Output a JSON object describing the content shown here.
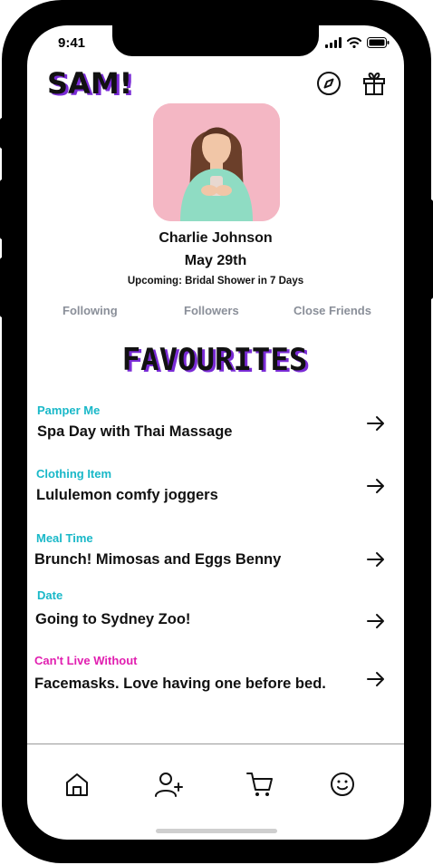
{
  "status_bar": {
    "time": "9:41"
  },
  "header": {
    "logo_text": "SAM!"
  },
  "profile": {
    "name": "Charlie Johnson",
    "birthday": "May 29th",
    "upcoming": "Upcoming: Bridal Shower in 7 Days"
  },
  "stats": {
    "following": "Following",
    "followers": "Followers",
    "close_friends": "Close Friends"
  },
  "favourites": {
    "title": "FAVOURITES",
    "items": [
      {
        "category": "Pamper Me",
        "text": "Spa Day with Thai Massage"
      },
      {
        "category": "Clothing Item",
        "text": "Lululemon comfy joggers"
      },
      {
        "category": "Meal Time",
        "text": "Brunch! Mimosas and Eggs Benny"
      },
      {
        "category": "Date",
        "text": "Going to Sydney Zoo!"
      },
      {
        "category": "Can't Live Without",
        "text": "Facemasks. Love having one before bed."
      }
    ]
  },
  "colors": {
    "category_teal": "#19b8c8",
    "category_pink": "#e11fb0",
    "avatar_bg": "#f4b7c4",
    "title_shadow": "#7a2bd6"
  },
  "icons": {
    "header": [
      "compass-icon",
      "gift-icon"
    ],
    "nav": [
      "home-icon",
      "add-user-icon",
      "cart-icon",
      "smiley-icon"
    ]
  }
}
